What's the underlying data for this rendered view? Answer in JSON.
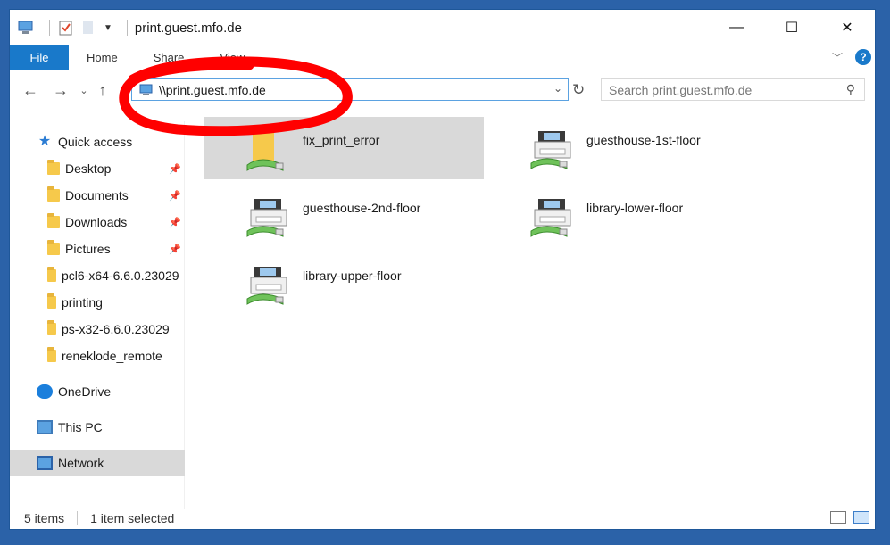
{
  "window": {
    "title": "print.guest.mfo.de",
    "controls": {
      "minimize": "—",
      "maximize": "☐",
      "close": "✕"
    }
  },
  "ribbon": {
    "tabs": [
      "File",
      "Home",
      "Share",
      "View"
    ],
    "help": "?"
  },
  "address": {
    "path": "\\\\print.guest.mfo.de",
    "search_placeholder": "Search print.guest.mfo.de"
  },
  "sidebar": {
    "quick_access": "Quick access",
    "items": [
      {
        "label": "Desktop",
        "pinned": true
      },
      {
        "label": "Documents",
        "pinned": true
      },
      {
        "label": "Downloads",
        "pinned": true
      },
      {
        "label": "Pictures",
        "pinned": true
      },
      {
        "label": "pcl6-x64-6.6.0.23029",
        "pinned": false
      },
      {
        "label": "printing",
        "pinned": false
      },
      {
        "label": "ps-x32-6.6.0.23029",
        "pinned": false
      },
      {
        "label": "reneklode_remote",
        "pinned": false
      }
    ],
    "onedrive": "OneDrive",
    "this_pc": "This PC",
    "network": "Network"
  },
  "items": [
    {
      "label": "fix_print_error",
      "type": "shared-folder",
      "selected": true
    },
    {
      "label": "guesthouse-1st-floor",
      "type": "printer",
      "selected": false
    },
    {
      "label": "guesthouse-2nd-floor",
      "type": "printer",
      "selected": false
    },
    {
      "label": "library-lower-floor",
      "type": "printer",
      "selected": false
    },
    {
      "label": "library-upper-floor",
      "type": "printer",
      "selected": false
    }
  ],
  "status": {
    "count": "5 items",
    "selected": "1 item selected"
  },
  "annotation_color": "#ff0000"
}
